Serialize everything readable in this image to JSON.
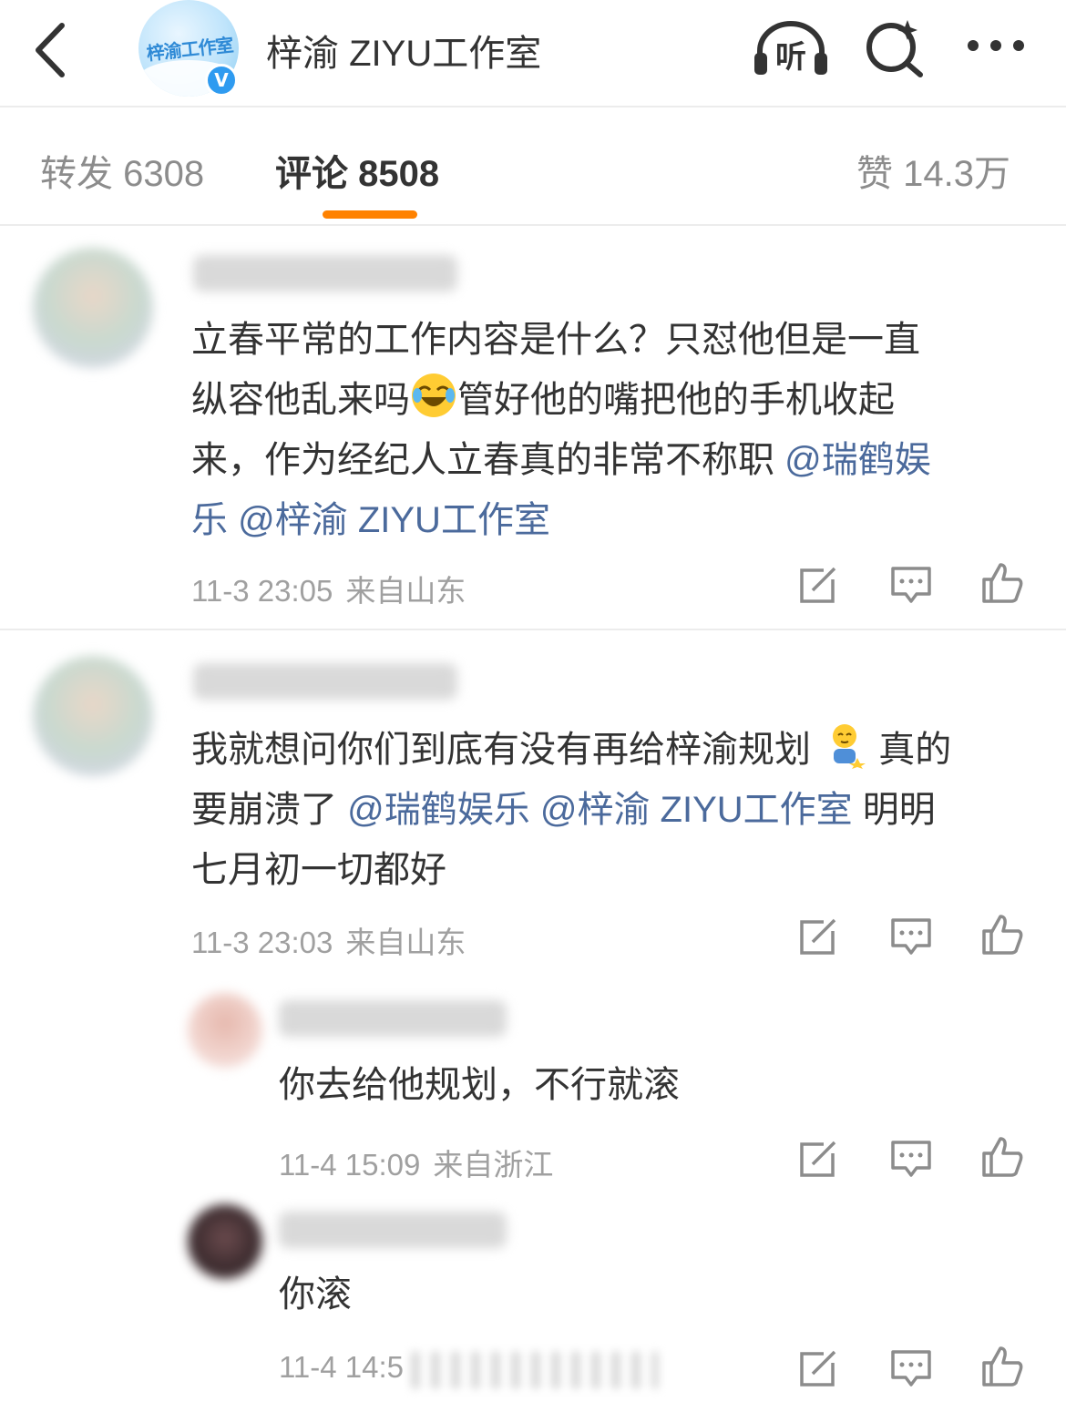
{
  "header": {
    "title": "梓渝 ZIYU工作室",
    "avatar_text": "梓渝工作室",
    "verified_badge": "V",
    "listen_label": "听"
  },
  "tabs": [
    {
      "label": "转发 6308"
    },
    {
      "label": "评论 8508"
    },
    {
      "label": "赞 14.3万"
    }
  ],
  "comments": [
    {
      "text_parts": [
        "立春平常的工作内容是什么？只怼他但是一直",
        "纵容他乱来吗",
        "管好他的嘴把他的手机收起",
        "来，作为经纪人立春真的非常不称职 ",
        "@瑞鹤娱",
        "乐 @梓渝 ZIYU工作室"
      ],
      "time": "11-3 23:05",
      "location": "来自山东"
    },
    {
      "text_parts": [
        "我就想问你们到底有没有再给梓渝规划",
        "真的",
        "要崩溃了 ",
        "@瑞鹤娱乐 @梓渝 ZIYU工作室",
        " 明明",
        "七月初一切都好"
      ],
      "time": "11-3 23:03",
      "location": "来自山东"
    },
    {
      "text": "你去给他规划，不行就滚",
      "time": "11-4 15:09",
      "location": "来自浙江"
    },
    {
      "text": "你滚",
      "time": "11-4 14:5"
    }
  ],
  "colors": {
    "accent": "#ff8200",
    "mention": "#4b6a9c",
    "meta": "#a0a0a0",
    "verified": "#2f9bf0"
  }
}
